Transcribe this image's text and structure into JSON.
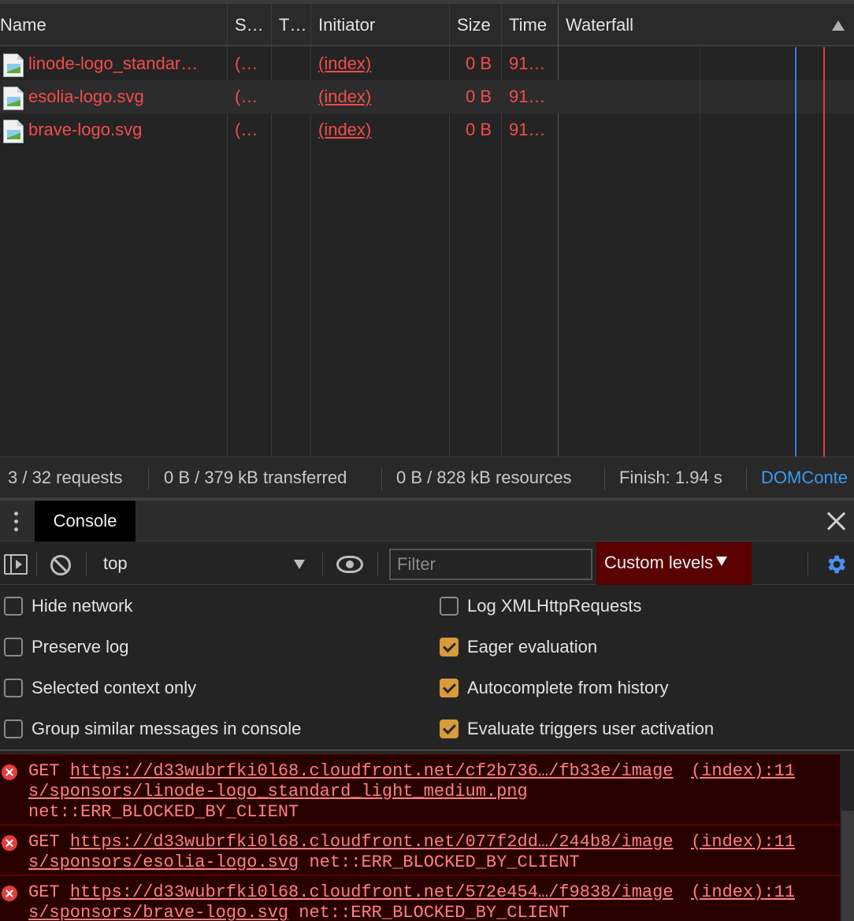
{
  "network": {
    "columns": {
      "name": "Name",
      "status": "S…",
      "type": "T…",
      "initiator": "Initiator",
      "size": "Size",
      "time": "Time",
      "waterfall": "Waterfall"
    },
    "rows": [
      {
        "name": "linode-logo_standar…",
        "status": "(…",
        "initiator": "(index)",
        "size": "0 B",
        "time": "91…"
      },
      {
        "name": "esolia-logo.svg",
        "status": "(…",
        "initiator": "(index)",
        "size": "0 B",
        "time": "91…"
      },
      {
        "name": "brave-logo.svg",
        "status": "(…",
        "initiator": "(index)",
        "size": "0 B",
        "time": "91…"
      }
    ],
    "waterfall_colors": {
      "dom_content_loaded": "#3b78e7",
      "load": "#e53d3d"
    }
  },
  "status_bar": {
    "requests": "3 / 32 requests",
    "transferred": "0 B / 379 kB transferred",
    "resources": "0 B / 828 kB resources",
    "finish": "Finish: 1.94 s",
    "dom": "DOMConte"
  },
  "drawer": {
    "tab_label": "Console"
  },
  "console_toolbar": {
    "context": "top",
    "filter_placeholder": "Filter",
    "levels_label": "Custom levels"
  },
  "settings": {
    "left": [
      {
        "label": "Hide network",
        "checked": false
      },
      {
        "label": "Preserve log",
        "checked": false
      },
      {
        "label": "Selected context only",
        "checked": false
      },
      {
        "label": "Group similar messages in console",
        "checked": false
      }
    ],
    "right": [
      {
        "label": "Log XMLHttpRequests",
        "checked": false
      },
      {
        "label": "Eager evaluation",
        "checked": true
      },
      {
        "label": "Autocomplete from history",
        "checked": true
      },
      {
        "label": "Evaluate triggers user activation",
        "checked": true
      }
    ]
  },
  "messages": [
    {
      "method": "GET",
      "url_line1": "https://d33wubrfki0l68.cloudfront.net/cf2b736…/fb33e/image",
      "url_line2": "s/sponsors/linode-logo_standard_light_medium.png",
      "error": "net::ERR_BLOCKED_BY_CLIENT",
      "source": "(index):11"
    },
    {
      "method": "GET",
      "url_line1": "https://d33wubrfki0l68.cloudfront.net/077f2dd…/244b8/image",
      "url_line2": "s/sponsors/esolia-logo.svg",
      "error": "net::ERR_BLOCKED_BY_CLIENT",
      "source": "(index):11"
    },
    {
      "method": "GET",
      "url_line1": "https://d33wubrfki0l68.cloudfront.net/572e454…/f9838/image",
      "url_line2": "s/sponsors/brave-logo.svg",
      "error": "net::ERR_BLOCKED_BY_CLIENT",
      "source": "(index):11"
    }
  ],
  "colors": {
    "error_text": "#f24c4c",
    "link_blue": "#3b9bef",
    "checkbox_checked": "#d89a3a",
    "levels_bg": "#5a0000"
  }
}
